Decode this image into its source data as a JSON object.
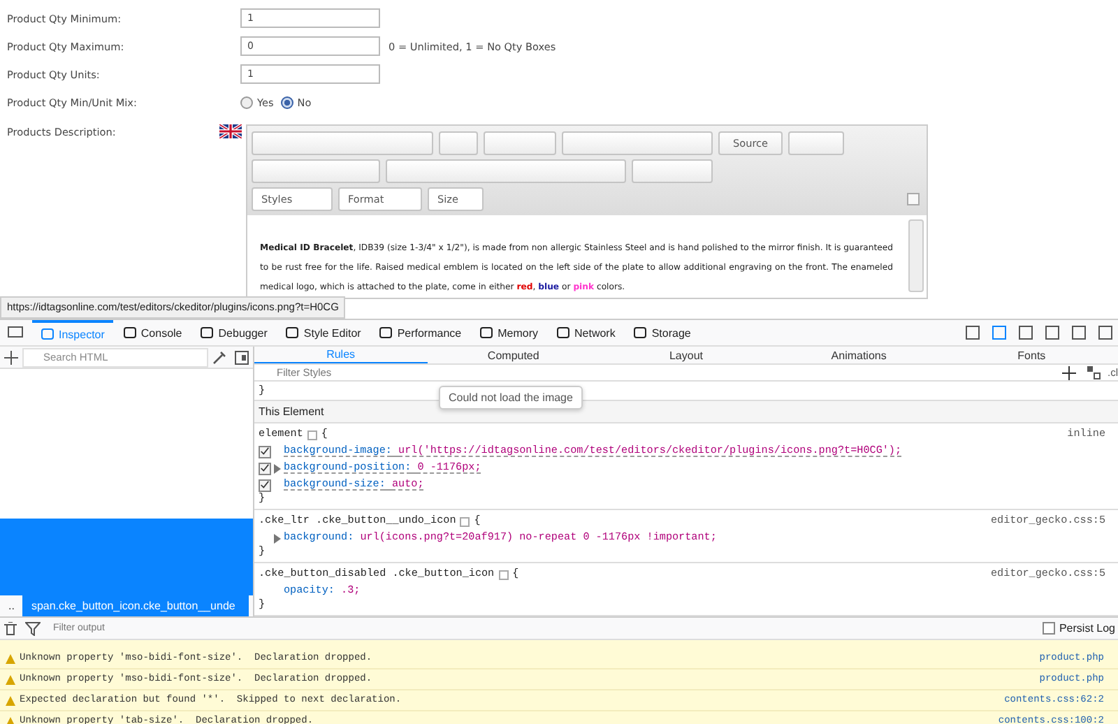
{
  "form": {
    "rows": [
      {
        "label": "Product Qty Minimum:",
        "kind": "text",
        "value": "1"
      },
      {
        "label": "Product Qty Maximum:",
        "kind": "text",
        "value": "0",
        "hint": "0 = Unlimited, 1 = No Qty Boxes"
      },
      {
        "label": "Product Qty Units:",
        "kind": "text",
        "value": "1"
      },
      {
        "label": "Product Qty Min/Unit Mix:",
        "kind": "radio",
        "options": [
          {
            "label": "Yes",
            "selected": false
          },
          {
            "label": "No",
            "selected": true
          }
        ]
      }
    ],
    "description": {
      "label": "Products Description:",
      "editor": {
        "source_button": "Source",
        "combos": [
          "Styles",
          "Format",
          "Size"
        ],
        "content": [
          {
            "text": "**Medical ID Bracelet**, IDB39 (size 1-3/4\" x 1/2\"), is made from non allergic Stainless Steel and is hand polished to the mirror finish. It is guaranteed to be rust free for the life. Raised medical emblem is located on the left side of the plate to allow additional engraving on the front. The enameled medical logo, which is attached to the plate, come in either "
          },
          {
            "text": "**red**",
            "color": "#e00000"
          },
          {
            "text": ", "
          },
          {
            "text": "**blue**",
            "color": "#1a1aa0"
          },
          {
            "text": " or "
          },
          {
            "text": "**pink**",
            "color": "#ff33cc"
          },
          {
            "text": " colors."
          }
        ]
      }
    }
  },
  "status_url": "https://idtagsonline.com/test/editors/ckeditor/plugins/icons.png?t=H0CG",
  "devtools": {
    "tabs": [
      {
        "label": "Inspector",
        "selected": true
      },
      {
        "label": "Console",
        "selected": false
      },
      {
        "label": "Debugger",
        "selected": false
      },
      {
        "label": "Style Editor",
        "selected": false
      },
      {
        "label": "Performance",
        "selected": false
      },
      {
        "label": "Memory",
        "selected": false
      },
      {
        "label": "Network",
        "selected": false
      },
      {
        "label": "Storage",
        "selected": false
      }
    ],
    "search_html": {
      "placeholder": "Search HTML"
    },
    "breadcrumb": [
      {
        "label": "..",
        "selected": false
      },
      {
        "label": "span.cke_button_icon.cke_button__unde",
        "selected": true
      }
    ],
    "side_tabs": [
      {
        "label": "Rules",
        "selected": true
      },
      {
        "label": "Computed",
        "selected": false
      },
      {
        "label": "Layout",
        "selected": false
      },
      {
        "label": "Animations",
        "selected": false
      },
      {
        "label": "Fonts",
        "selected": false
      }
    ],
    "filter_styles": {
      "placeholder": "Filter Styles"
    },
    "class_toggle": ".cl",
    "leading_brace": "}",
    "section_title": "This Element",
    "tooltip": "Could not load the image",
    "rules": [
      {
        "selector": "element",
        "open": "{",
        "close": "}",
        "source": "inline",
        "declarations": [
          {
            "name": "background-image:",
            "value": "url('https://idtagsonline.com/test/editors/ckeditor/plugins/icons.png?t=H0CG');",
            "checked": true,
            "overridden": true,
            "expandable": false
          },
          {
            "name": "background-position:",
            "value": "0 -1176px;",
            "checked": true,
            "overridden": true,
            "expandable": true
          },
          {
            "name": "background-size:",
            "value": "auto;",
            "checked": true,
            "overridden": true,
            "expandable": false
          }
        ]
      },
      {
        "selector": ".cke_ltr .cke_button__undo_icon",
        "open": "{",
        "close": "}",
        "source": "editor_gecko.css:5",
        "declarations": [
          {
            "name": "background:",
            "value": "url(icons.png?t=20af917) no-repeat 0 -1176px !important;",
            "overridden": false,
            "expandable": true
          }
        ]
      },
      {
        "selector": ".cke_button_disabled .cke_button_icon",
        "open": "{",
        "close": "}",
        "source": "editor_gecko.css:5",
        "declarations": [
          {
            "name": "opacity:",
            "value": ".3;",
            "overridden": false,
            "expandable": false
          }
        ]
      }
    ],
    "console": {
      "filter": {
        "placeholder": "Filter output"
      },
      "persist_log": {
        "label": "Persist Log",
        "checked": false
      },
      "messages": [
        {
          "text": "Unknown property 'mso-bidi-font-size'.  Declaration dropped.",
          "source": "product.php"
        },
        {
          "text": "Unknown property 'mso-bidi-font-size'.  Declaration dropped.",
          "source": "product.php"
        },
        {
          "text": "Expected declaration but found '*'.  Skipped to next declaration.",
          "source": "contents.css:62:2"
        },
        {
          "text": "Unknown property 'tab-size'.  Declaration dropped.",
          "source": "contents.css:100:2"
        }
      ]
    }
  }
}
